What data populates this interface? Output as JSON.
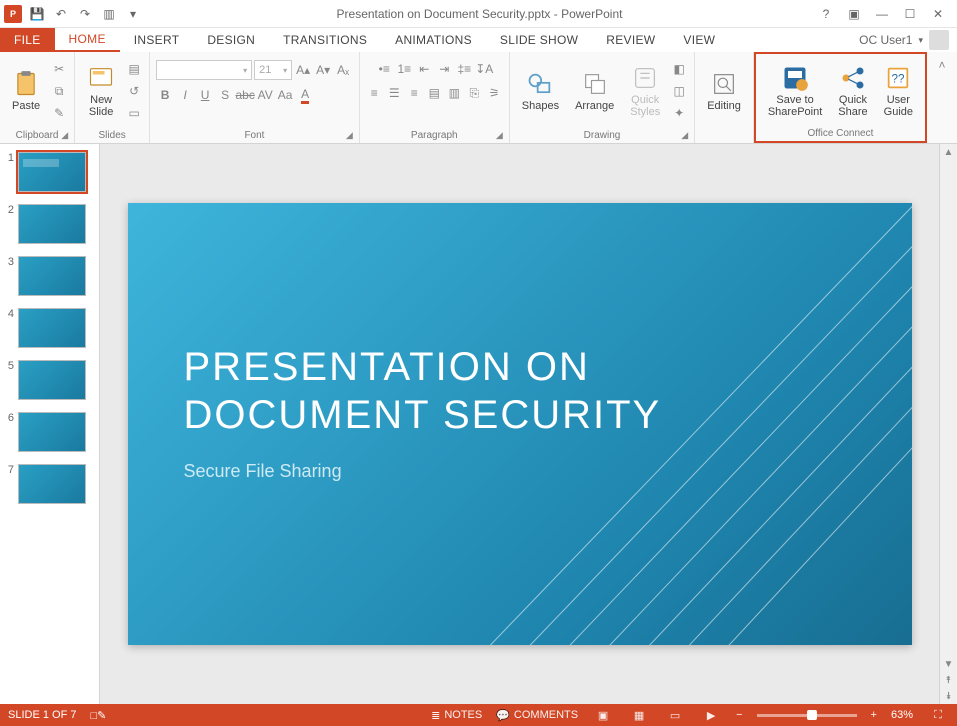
{
  "title": "Presentation on Document Security.pptx - PowerPoint",
  "user": "OC User1",
  "tabs": {
    "file": "FILE",
    "home": "HOME",
    "insert": "INSERT",
    "design": "DESIGN",
    "transitions": "TRANSITIONS",
    "animations": "ANIMATIONS",
    "slideshow": "SLIDE SHOW",
    "review": "REVIEW",
    "view": "VIEW"
  },
  "ribbon": {
    "clipboard": {
      "label": "Clipboard",
      "paste": "Paste"
    },
    "slides": {
      "label": "Slides",
      "new_slide": "New\nSlide"
    },
    "font": {
      "label": "Font",
      "size": "21"
    },
    "paragraph": {
      "label": "Paragraph"
    },
    "drawing": {
      "label": "Drawing",
      "shapes": "Shapes",
      "arrange": "Arrange",
      "quick_styles": "Quick\nStyles"
    },
    "editing": {
      "label": "Editing",
      "btn": "Editing"
    },
    "office_connect": {
      "label": "Office Connect",
      "save_sp": "Save to\nSharePoint",
      "quick_share": "Quick\nShare",
      "user_guide": "User\nGuide"
    }
  },
  "slide": {
    "title": "PRESENTATION ON DOCUMENT SECURITY",
    "subtitle": "Secure File Sharing"
  },
  "thumbnails": [
    1,
    2,
    3,
    4,
    5,
    6,
    7
  ],
  "status": {
    "slide_pos": "SLIDE 1 OF 7",
    "notes": "NOTES",
    "comments": "COMMENTS",
    "zoom": "63%",
    "zoom_pct": 63
  }
}
